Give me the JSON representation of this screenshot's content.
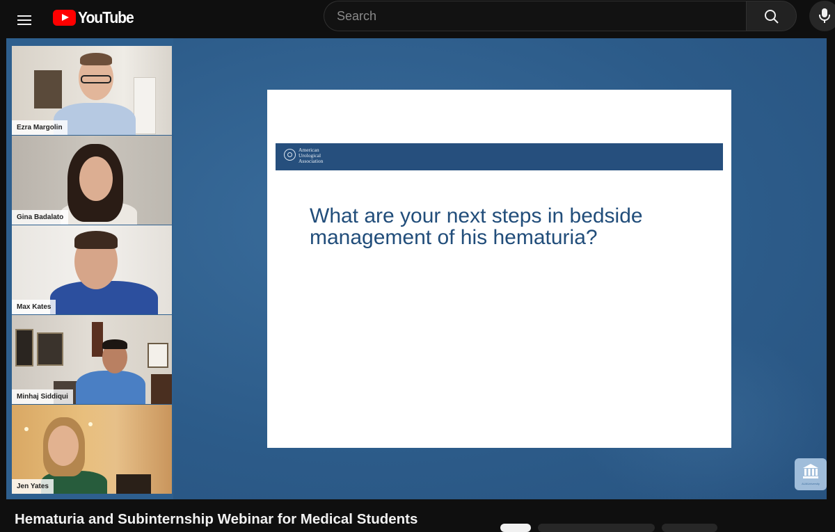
{
  "header": {
    "logo_text": "YouTube",
    "search_placeholder": "Search",
    "icons": [
      "menu-icon",
      "search-icon",
      "mic-icon"
    ]
  },
  "participants": [
    {
      "name": "Ezra Margolin"
    },
    {
      "name": "Gina Badalato"
    },
    {
      "name": "Max Kates"
    },
    {
      "name": "Minhaj Siddiqui"
    },
    {
      "name": "Jen Yates"
    }
  ],
  "slide": {
    "org_line1": "American",
    "org_line2": "Urological",
    "org_line3": "Association",
    "question_line1": "What are your next steps in bedside",
    "question_line2": "management of his hematuria?"
  },
  "watermark": {
    "text": "AUAUniversity",
    "icon": "institution-icon"
  },
  "video": {
    "title": "Hematuria and Subinternship Webinar for Medical Students"
  },
  "colors": {
    "youtube_red": "#ff0000",
    "background": "#0f0f0f",
    "slide_header": "#264f7d",
    "slide_text": "#214d7a",
    "video_bg": "#2e5f8e"
  }
}
